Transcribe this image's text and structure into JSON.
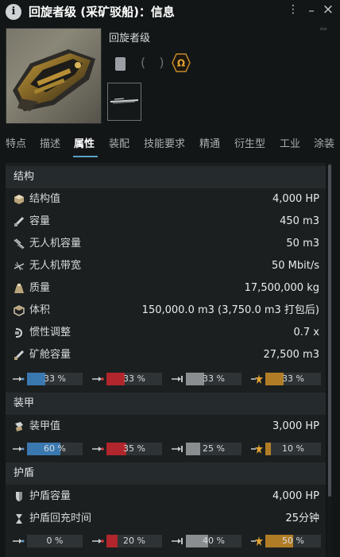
{
  "window": {
    "title": "回旋者级 (采矿驳船)：信息",
    "controls": {
      "menu": "⋮",
      "minimize": "–",
      "close": "×"
    }
  },
  "header": {
    "ship_name": "回旋者级",
    "collapse_arrows": "«»"
  },
  "tabs": [
    {
      "label": "特点",
      "active": false
    },
    {
      "label": "描述",
      "active": false
    },
    {
      "label": "属性",
      "active": true
    },
    {
      "label": "装配",
      "active": false
    },
    {
      "label": "技能要求",
      "active": false
    },
    {
      "label": "精通",
      "active": false
    },
    {
      "label": "衍生型",
      "active": false
    },
    {
      "label": "工业",
      "active": false
    },
    {
      "label": "涂装",
      "active": false
    }
  ],
  "sections": {
    "structure": {
      "title": "结构",
      "rows": [
        {
          "icon": "structure-hp-icon",
          "label": "结构值",
          "value": "4,000 HP"
        },
        {
          "icon": "capacity-icon",
          "label": "容量",
          "value": "450 m3"
        },
        {
          "icon": "drone-capacity-icon",
          "label": "无人机容量",
          "value": "50 m3"
        },
        {
          "icon": "drone-bandwidth-icon",
          "label": "无人机带宽",
          "value": "50 Mbit/s"
        },
        {
          "icon": "mass-icon",
          "label": "质量",
          "value": "17,500,000 kg"
        },
        {
          "icon": "volume-icon",
          "label": "体积",
          "value": "150,000.0 m3 (3,750.0 m3 打包后)"
        },
        {
          "icon": "inertia-icon",
          "label": "惯性调整",
          "value": "0.7 x"
        },
        {
          "icon": "ore-hold-icon",
          "label": "矿舱容量",
          "value": "27,500 m3"
        }
      ],
      "resists": [
        {
          "type": "em",
          "text": "33 %",
          "fraction": 0.33
        },
        {
          "type": "thermal",
          "text": "33 %",
          "fraction": 0.33
        },
        {
          "type": "kinetic",
          "text": "33 %",
          "fraction": 0.33
        },
        {
          "type": "explosive",
          "text": "33 %",
          "fraction": 0.33
        }
      ]
    },
    "armor": {
      "title": "装甲",
      "rows": [
        {
          "icon": "armor-hp-icon",
          "label": "装甲值",
          "value": "3,000 HP"
        }
      ],
      "resists": [
        {
          "type": "em",
          "text": "60 %",
          "fraction": 0.6
        },
        {
          "type": "thermal",
          "text": "35 %",
          "fraction": 0.35
        },
        {
          "type": "kinetic",
          "text": "25 %",
          "fraction": 0.25
        },
        {
          "type": "explosive",
          "text": "10 %",
          "fraction": 0.1
        }
      ]
    },
    "shield": {
      "title": "护盾",
      "rows": [
        {
          "icon": "shield-capacity-icon",
          "label": "护盾容量",
          "value": "4,000 HP"
        },
        {
          "icon": "hourglass-icon",
          "label": "护盾回充时间",
          "value": "25分钟"
        }
      ],
      "resists": [
        {
          "type": "em",
          "text": "0 %",
          "fraction": 0.0
        },
        {
          "type": "thermal",
          "text": "20 %",
          "fraction": 0.2
        },
        {
          "type": "kinetic",
          "text": "40 %",
          "fraction": 0.4
        },
        {
          "type": "explosive",
          "text": "50 %",
          "fraction": 0.5
        }
      ]
    }
  },
  "colors": {
    "em": "#3a78b0",
    "thermal": "#b0262c",
    "kinetic": "#8a8e90",
    "explosive": "#b07d26",
    "tab_accent": "#5aa0c8"
  }
}
